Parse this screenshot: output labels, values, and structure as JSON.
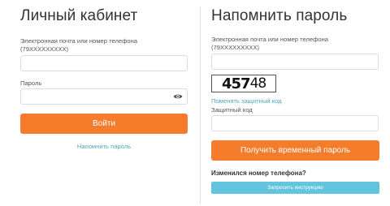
{
  "login": {
    "title": "Личный кабинет",
    "email_label": "Электронная почта или номер телефона\n(79XXXXXXXXX)",
    "email_value": "",
    "password_label": "Пароль",
    "password_value": "",
    "password_toggle_icon": "eye-icon",
    "submit_label": "Войти",
    "remind_link": "Напомнить пароль"
  },
  "remind": {
    "title": "Напомнить пароль",
    "email_label": "Электронная почта или номер телефона\n(79XXXXXXXXX)",
    "email_value": "",
    "captcha_part1": "457",
    "captcha_part2": "48",
    "change_captcha_link": "Поменять защитный код",
    "code_label": "Защитный код",
    "code_value": "",
    "submit_label": "Получить временный пароль",
    "phone_changed_heading": "Изменился номер телефона?",
    "request_instruction_label": "Запросить инструкцию"
  },
  "colors": {
    "primary_button": "#f47c2b",
    "link": "#4fa7c2",
    "secondary_button": "#62c5dd"
  }
}
